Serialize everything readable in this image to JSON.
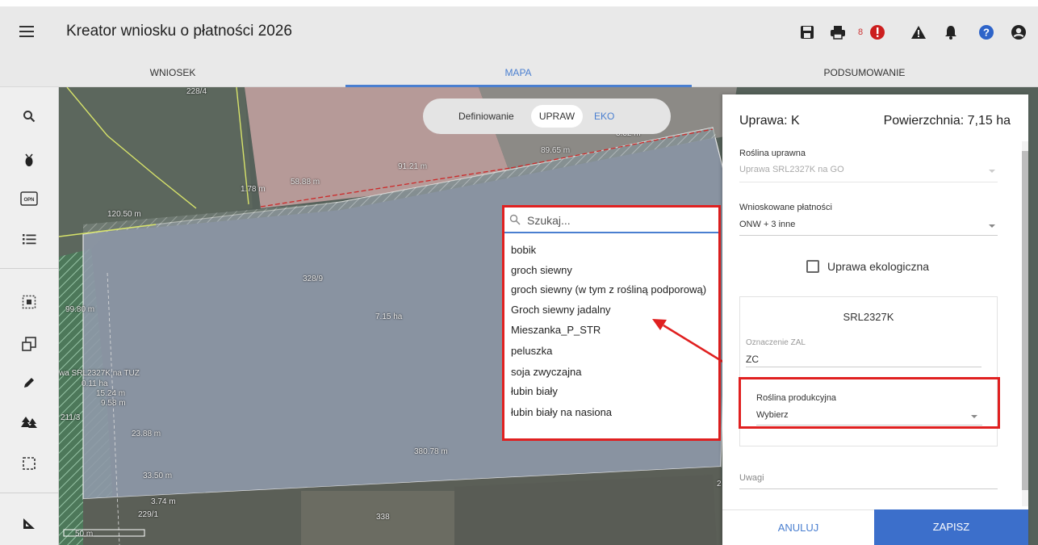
{
  "header": {
    "title": "Kreator wniosku o płatności 2026",
    "error_count": "8"
  },
  "tabs": [
    {
      "label": "WNIOSEK"
    },
    {
      "label": "MAPA"
    },
    {
      "label": "PODSUMOWANIE"
    }
  ],
  "left_toolbar": {
    "items": [
      "search",
      "insect-marker",
      "opn",
      "list",
      "select-area",
      "copy-shape",
      "pencil",
      "forest",
      "rectangle-select",
      "measure"
    ],
    "opn_label": "OPN"
  },
  "map": {
    "mode_label": "Definiowanie",
    "mode_upraw": "UPRAW",
    "mode_eko": "EKO",
    "labels": [
      "89.65 m",
      "91.21 m",
      "58.88 m",
      "1.78 m",
      "120.50 m",
      "99.80 m",
      "328/9",
      "7.15 ha",
      "wa SRL2327K na TUZ",
      "0.11 ha",
      "15.24 m",
      "9.58 m",
      "211/3",
      "23.88 m",
      "380.78 m",
      "33.50 m",
      "3.74 m",
      "229/1",
      "338",
      "228/4",
      "50 m",
      "3.32 m",
      "2"
    ]
  },
  "dropdown": {
    "search_placeholder": "Szukaj...",
    "items": [
      "bobik",
      "groch siewny",
      "groch siewny (w tym z rośliną podporową)",
      "Groch siewny jadalny",
      "Mieszanka_P_STR",
      "peluszka",
      "soja zwyczajna",
      "łubin biały",
      "łubin biały na nasiona"
    ]
  },
  "panel": {
    "title": "Uprawa: K",
    "area": "Powierzchnia: 7,15 ha",
    "roslina_uprawna_label": "Roślina uprawna",
    "roslina_uprawna_value": "Uprawa SRL2327K na GO",
    "platnosci_label": "Wnioskowane płatności",
    "platnosci_value": "ONW + 3 inne",
    "eko_label": "Uprawa ekologiczna",
    "card_title": "SRL2327K",
    "zal_label": "Oznaczenie ZAL",
    "zal_value": "ZC",
    "produkcyjna_label": "Roślina produkcyjna",
    "produkcyjna_value": "Wybierz",
    "uwagi_label": "Uwagi",
    "cancel": "ANULUJ",
    "save": "ZAPISZ"
  },
  "colors": {
    "accent": "#4a7fd0",
    "highlight": "#e02020",
    "save_button": "#3c6fcb",
    "error_badge": "#cc1f1f",
    "help_icon": "#2e64c9"
  }
}
